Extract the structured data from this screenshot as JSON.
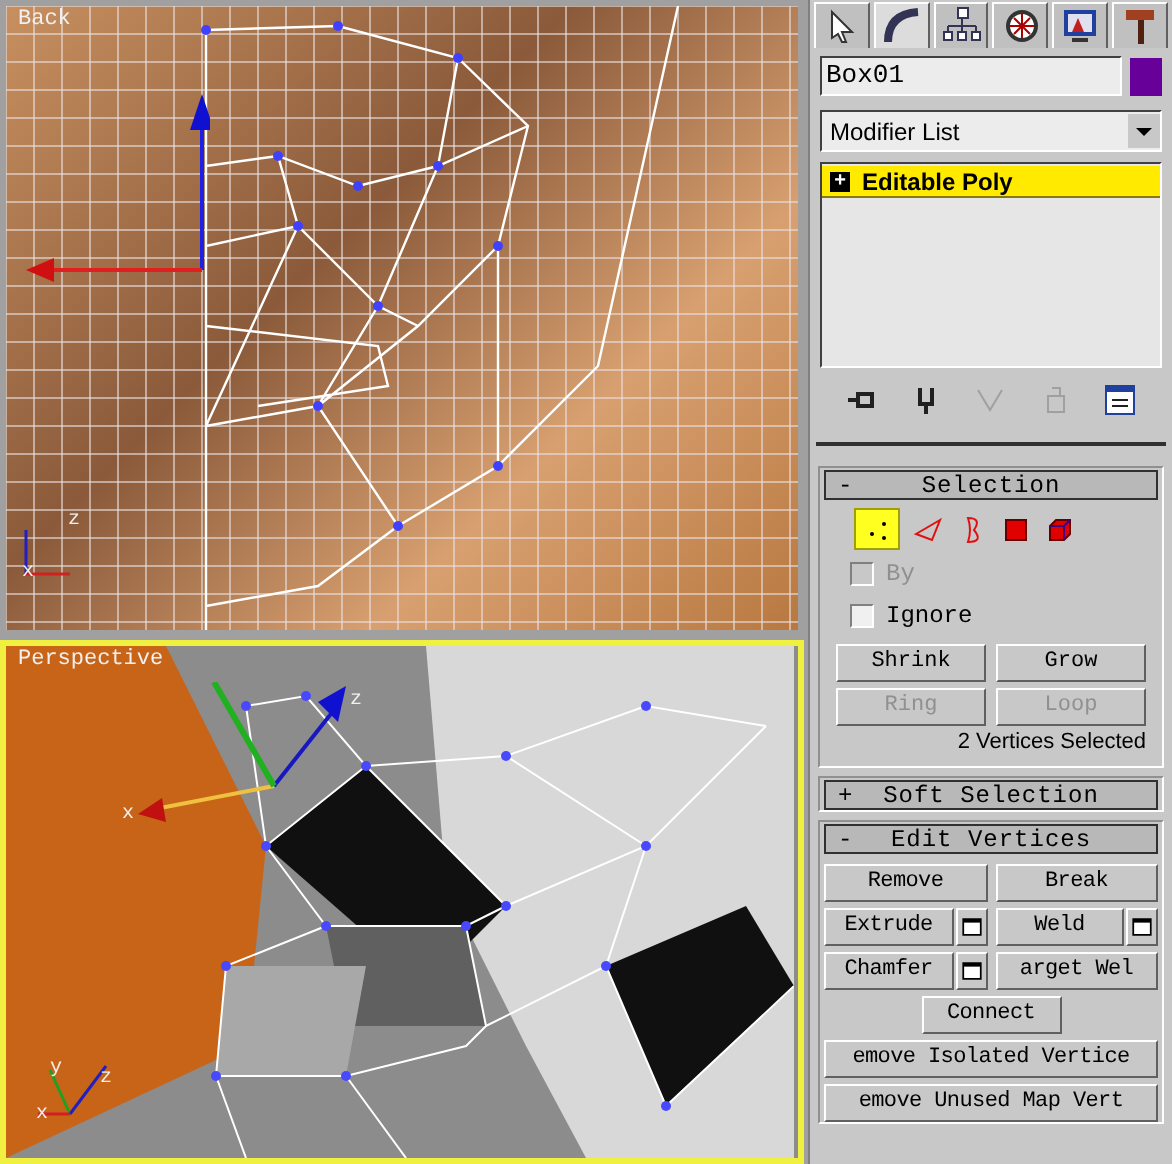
{
  "viewports": [
    {
      "kind": "photo",
      "label": "Back",
      "active": false,
      "axis_labels": [
        "z",
        "x"
      ]
    },
    {
      "kind": "shaded",
      "label": "Perspective",
      "active": true,
      "axis_labels": [
        "z",
        "x",
        "y",
        "z",
        "x"
      ]
    }
  ],
  "command_tabs": [
    {
      "selected": false
    },
    {
      "selected": true
    },
    {
      "selected": false
    },
    {
      "selected": false
    },
    {
      "selected": false
    },
    {
      "selected": false
    }
  ],
  "object": {
    "name": "Box01",
    "color": "#660099"
  },
  "modifier_list": {
    "value": "Modifier List"
  },
  "stack": [
    {
      "toggle": "+",
      "name": "Editable Poly",
      "selected": true
    }
  ],
  "stack_tools": [
    {
      "disabled": false
    },
    {
      "disabled": false
    },
    {
      "disabled": true
    },
    {
      "disabled": true
    },
    {
      "disabled": false
    }
  ],
  "rollouts": [
    {
      "toggle": "-",
      "title": "Selection",
      "kind": "selection"
    },
    {
      "toggle": "+",
      "title": "Soft Selection",
      "kind": "soft"
    },
    {
      "toggle": "-",
      "title": "Edit Vertices",
      "kind": "edit"
    }
  ],
  "subobjects": [
    {
      "selected": true
    },
    {
      "selected": false
    },
    {
      "selected": false
    },
    {
      "selected": false
    },
    {
      "selected": false
    }
  ],
  "checkboxes": [
    {
      "label": "By",
      "checked": false,
      "disabled": true
    },
    {
      "label": "Ignore",
      "checked": false,
      "disabled": false
    }
  ],
  "selection_buttons": [
    {
      "label": "Shrink",
      "disabled": false
    },
    {
      "label": "Grow",
      "disabled": false
    },
    {
      "label": "Ring",
      "disabled": true
    },
    {
      "label": "Loop",
      "disabled": true
    }
  ],
  "selection_status": "2 Vertices Selected",
  "edit_rows": [
    [
      {
        "label": "Remove",
        "settings": false
      },
      {
        "label": "Break",
        "settings": false
      }
    ],
    [
      {
        "label": "Extrude",
        "settings": true
      },
      {
        "label": "Weld",
        "settings": true
      }
    ],
    [
      {
        "label": "Chamfer",
        "settings": true
      },
      {
        "label": "arget Wel",
        "settings": false
      }
    ],
    [
      {
        "label": "Connect",
        "settings": false
      }
    ],
    [
      {
        "label": "emove Isolated Vertice",
        "settings": false
      }
    ],
    [
      {
        "label": "emove Unused Map Vert",
        "settings": false
      }
    ]
  ]
}
